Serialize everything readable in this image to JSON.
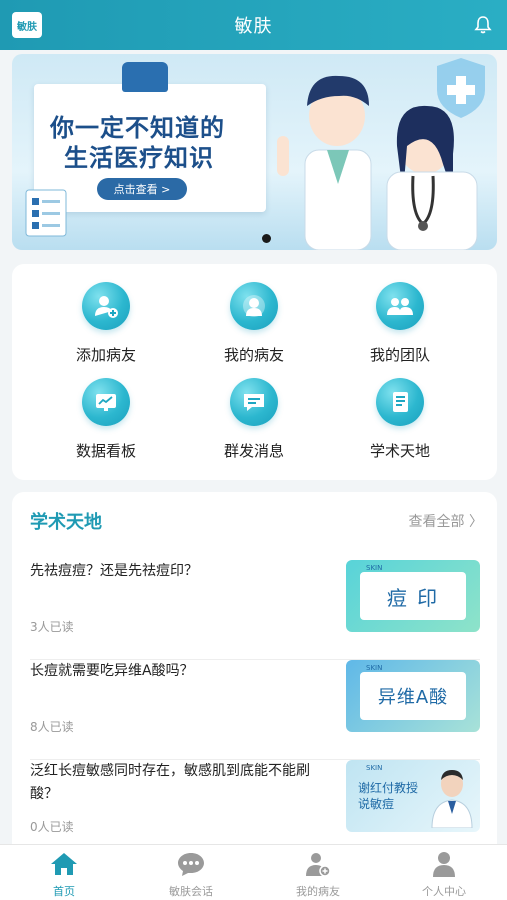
{
  "header": {
    "logo_text": "敏肤",
    "title": "敏肤"
  },
  "banner": {
    "line1": "你一定不知道的",
    "line2": "生活医疗知识",
    "button": "点击查看 >"
  },
  "quick_links": [
    {
      "label": "添加病友",
      "icon": "add-patient-icon"
    },
    {
      "label": "我的病友",
      "icon": "patient-icon"
    },
    {
      "label": "我的团队",
      "icon": "team-icon"
    },
    {
      "label": "数据看板",
      "icon": "dashboard-icon"
    },
    {
      "label": "群发消息",
      "icon": "broadcast-message-icon"
    },
    {
      "label": "学术天地",
      "icon": "academic-icon"
    }
  ],
  "academic": {
    "title": "学术天地",
    "view_all": "查看全部",
    "articles": [
      {
        "title": "先祛痘痘？还是先祛痘印？",
        "reads": "3人已读",
        "thumb_text": "痘 印"
      },
      {
        "title": "长痘就需要吃异维A酸吗？",
        "reads": "8人已读",
        "thumb_text": "异维A酸"
      },
      {
        "title": "泛红长痘敏感同时存在，敏感肌到底能不能刷酸？",
        "reads": "0人已读",
        "thumb_text": "谢红付教授 说敏痘"
      }
    ]
  },
  "bottom_nav": [
    {
      "label": "首页",
      "active": true
    },
    {
      "label": "敏肤会话",
      "active": false
    },
    {
      "label": "我的病友",
      "active": false
    },
    {
      "label": "个人中心",
      "active": false
    }
  ],
  "colors": {
    "primary": "#1f9ab3",
    "nav_active": "#1f9ab3"
  }
}
